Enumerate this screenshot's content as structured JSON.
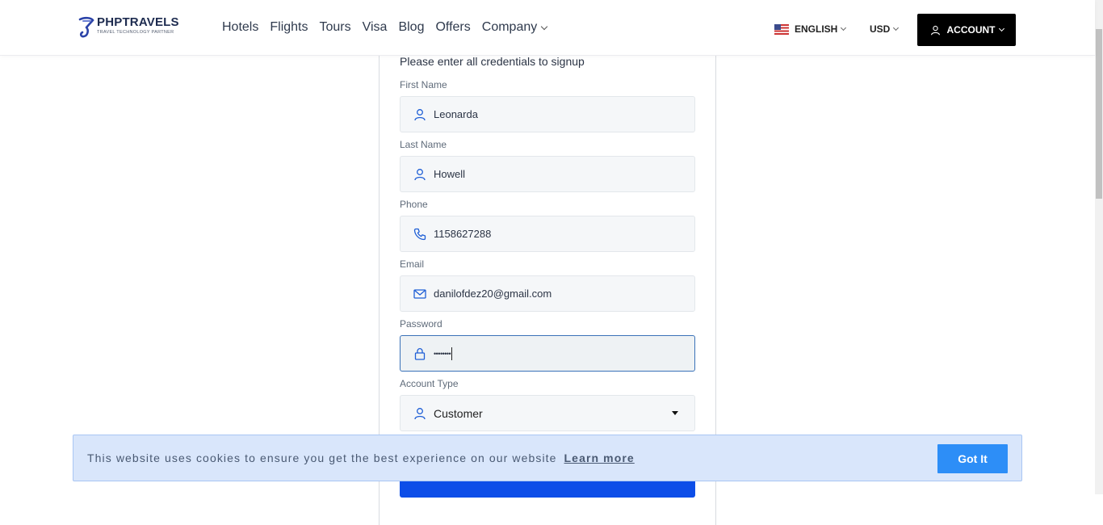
{
  "brand": {
    "name": "PHPTRAVELS",
    "tagline": "TRAVEL TECHNOLOGY PARTNER"
  },
  "nav": {
    "items": [
      "Hotels",
      "Flights",
      "Tours",
      "Visa",
      "Blog",
      "Offers"
    ],
    "company": "Company"
  },
  "header": {
    "language": "ENGLISH",
    "currency": "USD",
    "account": "ACCOUNT"
  },
  "form": {
    "intro": "Please enter all credentials to signup",
    "first_name": {
      "label": "First Name",
      "value": "Leonarda",
      "icon": "user-icon"
    },
    "last_name": {
      "label": "Last Name",
      "value": "Howell",
      "icon": "user-icon"
    },
    "phone": {
      "label": "Phone",
      "value": "1158627288",
      "icon": "phone-icon"
    },
    "email": {
      "label": "Email",
      "value": "danilofdez20@gmail.com",
      "icon": "mail-icon"
    },
    "password": {
      "label": "Password",
      "value": "••••••••",
      "icon": "lock-icon"
    },
    "account_type": {
      "label": "Account Type",
      "value": "Customer",
      "icon": "user-icon"
    }
  },
  "cookie": {
    "text": "This website uses cookies to ensure you get the best experience on our website",
    "link": "Learn more",
    "button": "Got It"
  },
  "colors": {
    "primary_blue": "#0d4ee8",
    "cookie_bg": "#d9e6fb",
    "got_it": "#2d8ef7",
    "icon_blue": "#1f5fd6"
  }
}
